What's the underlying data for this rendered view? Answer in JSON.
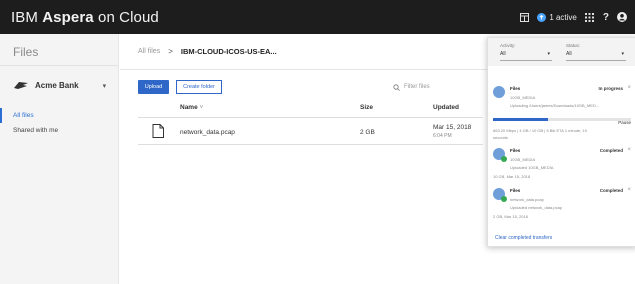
{
  "app": {
    "brand": "IBM",
    "product": "Aspera",
    "suffix": "on Cloud",
    "active_label": "1 active"
  },
  "sidebar": {
    "title": "Files",
    "org": "Acme Bank",
    "items": [
      {
        "label": "All files"
      },
      {
        "label": "Shared with me"
      }
    ]
  },
  "breadcrumb": {
    "root": "All files",
    "sep": ">",
    "current": "IBM-CLOUD-ICOS-US-EA..."
  },
  "toolbar": {
    "upload_label": "Upload",
    "create_folder_label": "Create folder",
    "filter_placeholder": "Filter files"
  },
  "table": {
    "columns": [
      "Name",
      "Size",
      "Updated"
    ],
    "rows": [
      {
        "name": "network_data.pcap",
        "size": "2 GB",
        "date": "Mar 15, 2018",
        "time": "6:04 PM"
      }
    ]
  },
  "transfers": {
    "activity_label": "Activity:",
    "activity_value": "All",
    "status_label": "Status:",
    "status_value": "All",
    "items": [
      {
        "title": "Files",
        "status": "In progress",
        "line1": "10GB_MEDIA",
        "line2": "Uploading /Users/james/Downloads/10GB_MED...",
        "detail": "663.20 Mbps | 4 GB / 10 GB | 6 Blk ETA 1 minute, 19",
        "detail2": "seconds",
        "action": "Pause",
        "progress": 0.4
      },
      {
        "title": "Files",
        "status": "Completed",
        "line1": "10GB_MEDIA",
        "line2": "Uploaded 10GB_MEDIA",
        "detail": "10 GB, Mar 15, 2018"
      },
      {
        "title": "Files",
        "status": "Completed",
        "line1": "network_data.pcap",
        "line2": "Uploaded network_data.pcap",
        "detail": "2 GB, Mar 15, 2018"
      }
    ],
    "clear_label": "Clear completed transfers"
  },
  "colors": {
    "topbar": "#1d1d1d",
    "accent": "#2e67c7",
    "success": "#35a853"
  }
}
